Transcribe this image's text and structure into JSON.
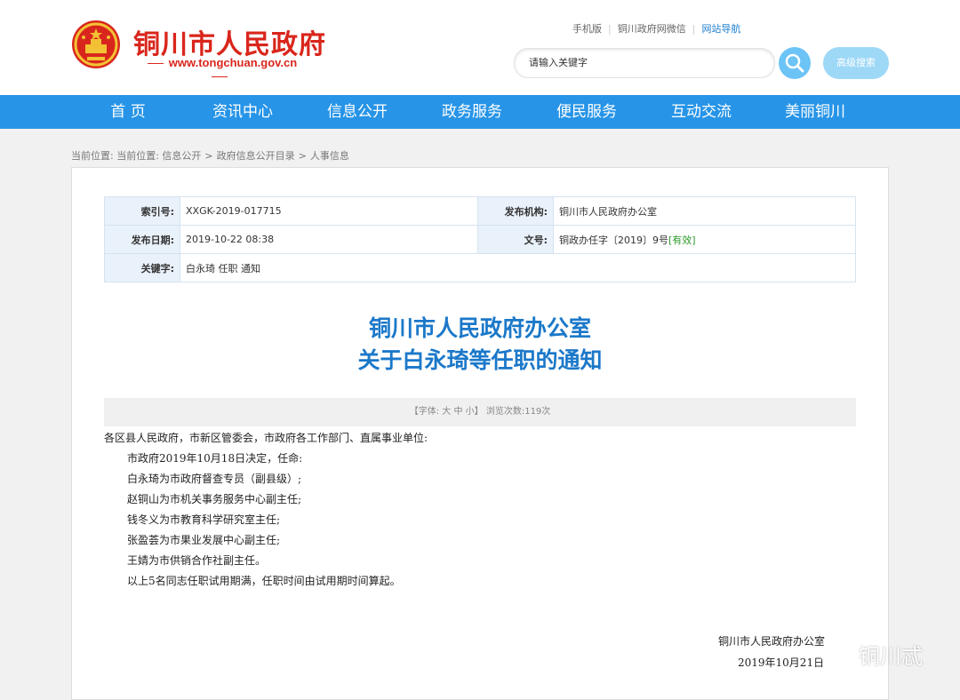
{
  "header": {
    "site_title": "铜川市人民政府",
    "site_url": "www.tongchuan.gov.cn",
    "top_links": [
      "手机版",
      "铜川政府网微信",
      "网站导航"
    ],
    "search_placeholder": "请输入关键字",
    "advanced_search_label": "高级搜索"
  },
  "nav": [
    "首 页",
    "资讯中心",
    "信息公开",
    "政务服务",
    "便民服务",
    "互动交流",
    "美丽铜川"
  ],
  "breadcrumb": [
    "当前位置: 当前位置: 信息公开",
    "政府信息公开目录",
    "人事信息"
  ],
  "meta": {
    "index_label": "索引号:",
    "index_value": "XXGK-2019-017715",
    "publisher_label": "发布机构:",
    "publisher_value": "铜川市人民政府办公室",
    "date_label": "发布日期:",
    "date_value": "2019-10-22 08:38",
    "doc_no_label": "文号:",
    "doc_no_value": "铜政办任字〔2019〕9号",
    "validity": "[有效]",
    "keywords_label": "关键字:",
    "keywords_value": "白永琦 任职 通知"
  },
  "document": {
    "title_line1": "铜川市人民政府办公室",
    "title_line2": "关于白永琦等任职的通知",
    "font_label": "【字体:",
    "font_large": "大",
    "font_medium": "中",
    "font_small": "小",
    "font_end": "】",
    "views_label": "浏览次数:",
    "views_count": "119次",
    "salutation": "各区县人民政府，市新区管委会，市政府各工作部门、直属事业单位:",
    "paragraphs": [
      "市政府2019年10月18日决定，任命:",
      "白永琦为市政府督查专员（副县级）;",
      "赵铜山为市机关事务服务中心副主任;",
      "钱冬义为市教育科学研究室主任;",
      "张盈荟为市果业发展中心副主任;",
      "王婧为市供销合作社副主任。",
      "以上5名同志任职试用期满，任职时间由试用期时间算起。"
    ],
    "signature": "铜川市人民政府办公室",
    "sign_date": "2019年10月21日"
  },
  "watermark": "铜川忒",
  "colors": {
    "brand_red": "#d9261c",
    "nav_blue": "#2794e7",
    "title_blue": "#1b78c9",
    "valid_green": "#2c9a2c"
  }
}
